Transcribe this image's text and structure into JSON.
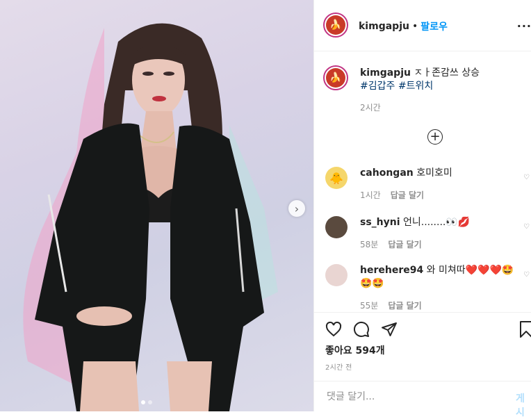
{
  "post": {
    "username": "kimgapju",
    "separator": "•",
    "follow_label": "팔로우",
    "more_label": "···"
  },
  "caption": {
    "username": "kimgapju",
    "text": "ㅈㅏ존감쓰 상승",
    "hashtags": [
      "#김갑주",
      "#트위치"
    ],
    "time": "2시간"
  },
  "comments": [
    {
      "username": "cahongan",
      "text": "호미호미",
      "time": "1시간",
      "reply": "답글 달기"
    },
    {
      "username": "ss_hyni",
      "text": "언니........👀💋",
      "time": "58분",
      "reply": "답글 달기"
    },
    {
      "username": "herehere94",
      "text": "와 미쳐따❤️❤️❤️🤩",
      "text2": "🤩🤩",
      "time": "55분",
      "reply": "답글 달기"
    }
  ],
  "likes": "좋아요 594개",
  "post_time": "2시간 전",
  "comment_input": {
    "placeholder": "댓글 달기..."
  },
  "post_button": "게시",
  "carousel": {
    "current": 1,
    "total": 2
  },
  "colors": {
    "accent": "#0095f6",
    "hashtag": "#00376b",
    "muted": "#8e8e8e",
    "heart": "#ed4956"
  },
  "icons": [
    "heart-icon",
    "comment-icon",
    "share-icon",
    "bookmark-icon",
    "plus-circle-icon",
    "chevron-right-icon"
  ]
}
